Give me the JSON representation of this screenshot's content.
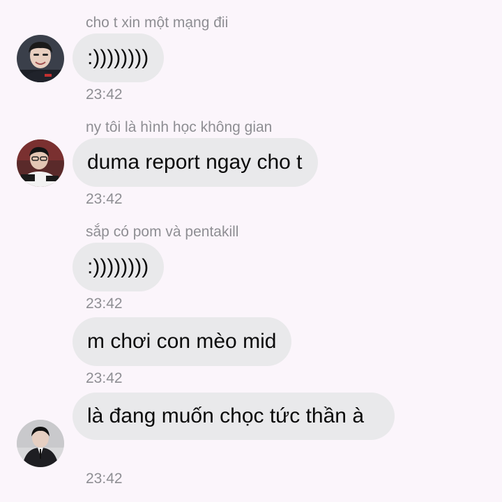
{
  "messages": [
    {
      "sender": "cho t xin một mạng đii",
      "text": ":))))))))",
      "time": "23:42"
    },
    {
      "sender": "ny tôi là hình học không gian",
      "text": "duma report ngay cho t",
      "time": "23:42"
    },
    {
      "sender": "sắp có pom và pentakill",
      "text": ":))))))))",
      "time": "23:42"
    },
    {
      "text": "m chơi con mèo mid",
      "time": "23:42"
    },
    {
      "text": "là đang muốn chọc tức thần à",
      "time": "23:42"
    }
  ],
  "colors": {
    "background": "#fbf5fb",
    "bubble": "#e9e9eb",
    "meta_text": "#8e8e93",
    "message_text": "#0a0a0a"
  }
}
